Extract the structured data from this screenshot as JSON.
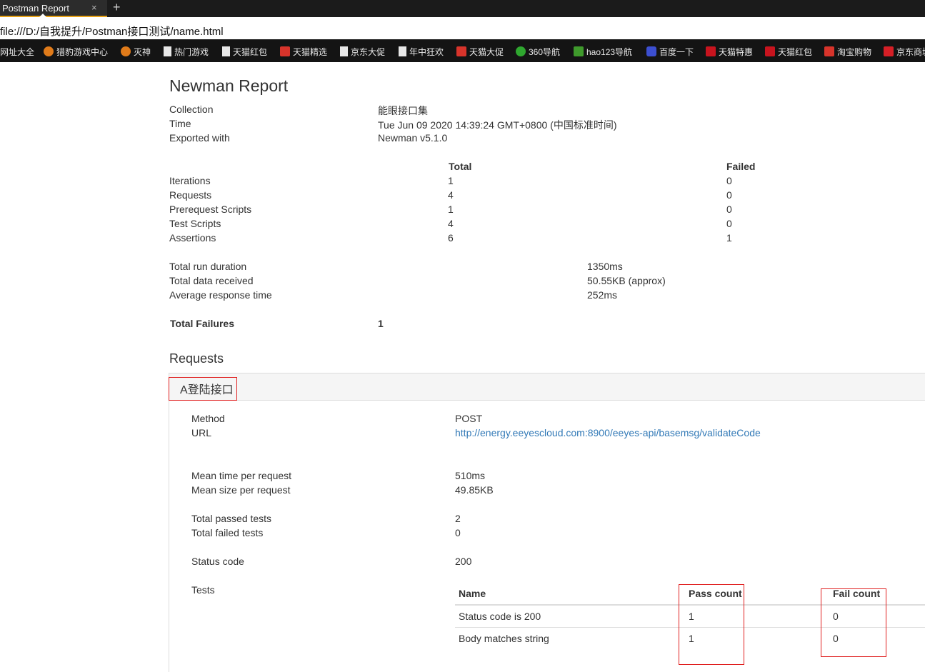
{
  "browser": {
    "tab_title": "Postman Report",
    "tab_close": "×",
    "new_tab": "+",
    "url": "file:///D:/自我提升/Postman接口测试/name.html",
    "bookmarks": [
      {
        "label": "网址大全",
        "icon": "none"
      },
      {
        "label": "猎豹游戏中心",
        "icon": "liebao-icon"
      },
      {
        "label": "灭神",
        "icon": "liebao-icon"
      },
      {
        "label": "热门游戏",
        "icon": "document-icon"
      },
      {
        "label": "天猫红包",
        "icon": "document-icon"
      },
      {
        "label": "天猫精选",
        "icon": "taobao-icon"
      },
      {
        "label": "京东大促",
        "icon": "document-icon"
      },
      {
        "label": "年中狂欢",
        "icon": "document-icon"
      },
      {
        "label": "天猫大促",
        "icon": "taobao-icon"
      },
      {
        "label": "360导航",
        "icon": "360-icon"
      },
      {
        "label": "hao123导航",
        "icon": "hao123-icon"
      },
      {
        "label": "百度一下",
        "icon": "baidu-icon"
      },
      {
        "label": "天猫特惠",
        "icon": "tmall-icon"
      },
      {
        "label": "天猫红包",
        "icon": "tmall-icon"
      },
      {
        "label": "淘宝购物",
        "icon": "taobao-icon"
      },
      {
        "label": "京东商城",
        "icon": "jd-icon"
      }
    ]
  },
  "report": {
    "title": "Newman Report",
    "meta": {
      "collection_label": "Collection",
      "collection_value": "能眼接口集",
      "time_label": "Time",
      "time_value": "Tue Jun 09 2020 14:39:24 GMT+0800 (中国标准时间)",
      "exported_label": "Exported with",
      "exported_value": "Newman v5.1.0"
    },
    "summary": {
      "col_total": "Total",
      "col_failed": "Failed",
      "rows": [
        {
          "label": "Iterations",
          "total": "1",
          "failed": "0"
        },
        {
          "label": "Requests",
          "total": "4",
          "failed": "0"
        },
        {
          "label": "Prerequest Scripts",
          "total": "1",
          "failed": "0"
        },
        {
          "label": "Test Scripts",
          "total": "4",
          "failed": "0"
        },
        {
          "label": "Assertions",
          "total": "6",
          "failed": "1"
        }
      ]
    },
    "timings": [
      {
        "label": "Total run duration",
        "value": "1350ms"
      },
      {
        "label": "Total data received",
        "value": "50.55KB (approx)"
      },
      {
        "label": "Average response time",
        "value": "252ms"
      }
    ],
    "total_failures_label": "Total Failures",
    "total_failures_value": "1",
    "requests_heading": "Requests",
    "request": {
      "name": "A登陆接口",
      "method_label": "Method",
      "method_value": "POST",
      "url_label": "URL",
      "url_value": "http://energy.eeyescloud.com:8900/eeyes-api/basemsg/validateCode",
      "mean_time_label": "Mean time per request",
      "mean_time_value": "510ms",
      "mean_size_label": "Mean size per request",
      "mean_size_value": "49.85KB",
      "passed_label": "Total passed tests",
      "passed_value": "2",
      "failed_label": "Total failed tests",
      "failed_value": "0",
      "status_label": "Status code",
      "status_value": "200",
      "tests_label": "Tests",
      "tests_table": {
        "col_name": "Name",
        "col_pass": "Pass count",
        "col_fail": "Fail count",
        "rows": [
          {
            "name": "Status code is 200",
            "pass": "1",
            "fail": "0"
          },
          {
            "name": "Body matches string",
            "pass": "1",
            "fail": "0"
          }
        ]
      }
    }
  },
  "annotation_color": "#e02020"
}
